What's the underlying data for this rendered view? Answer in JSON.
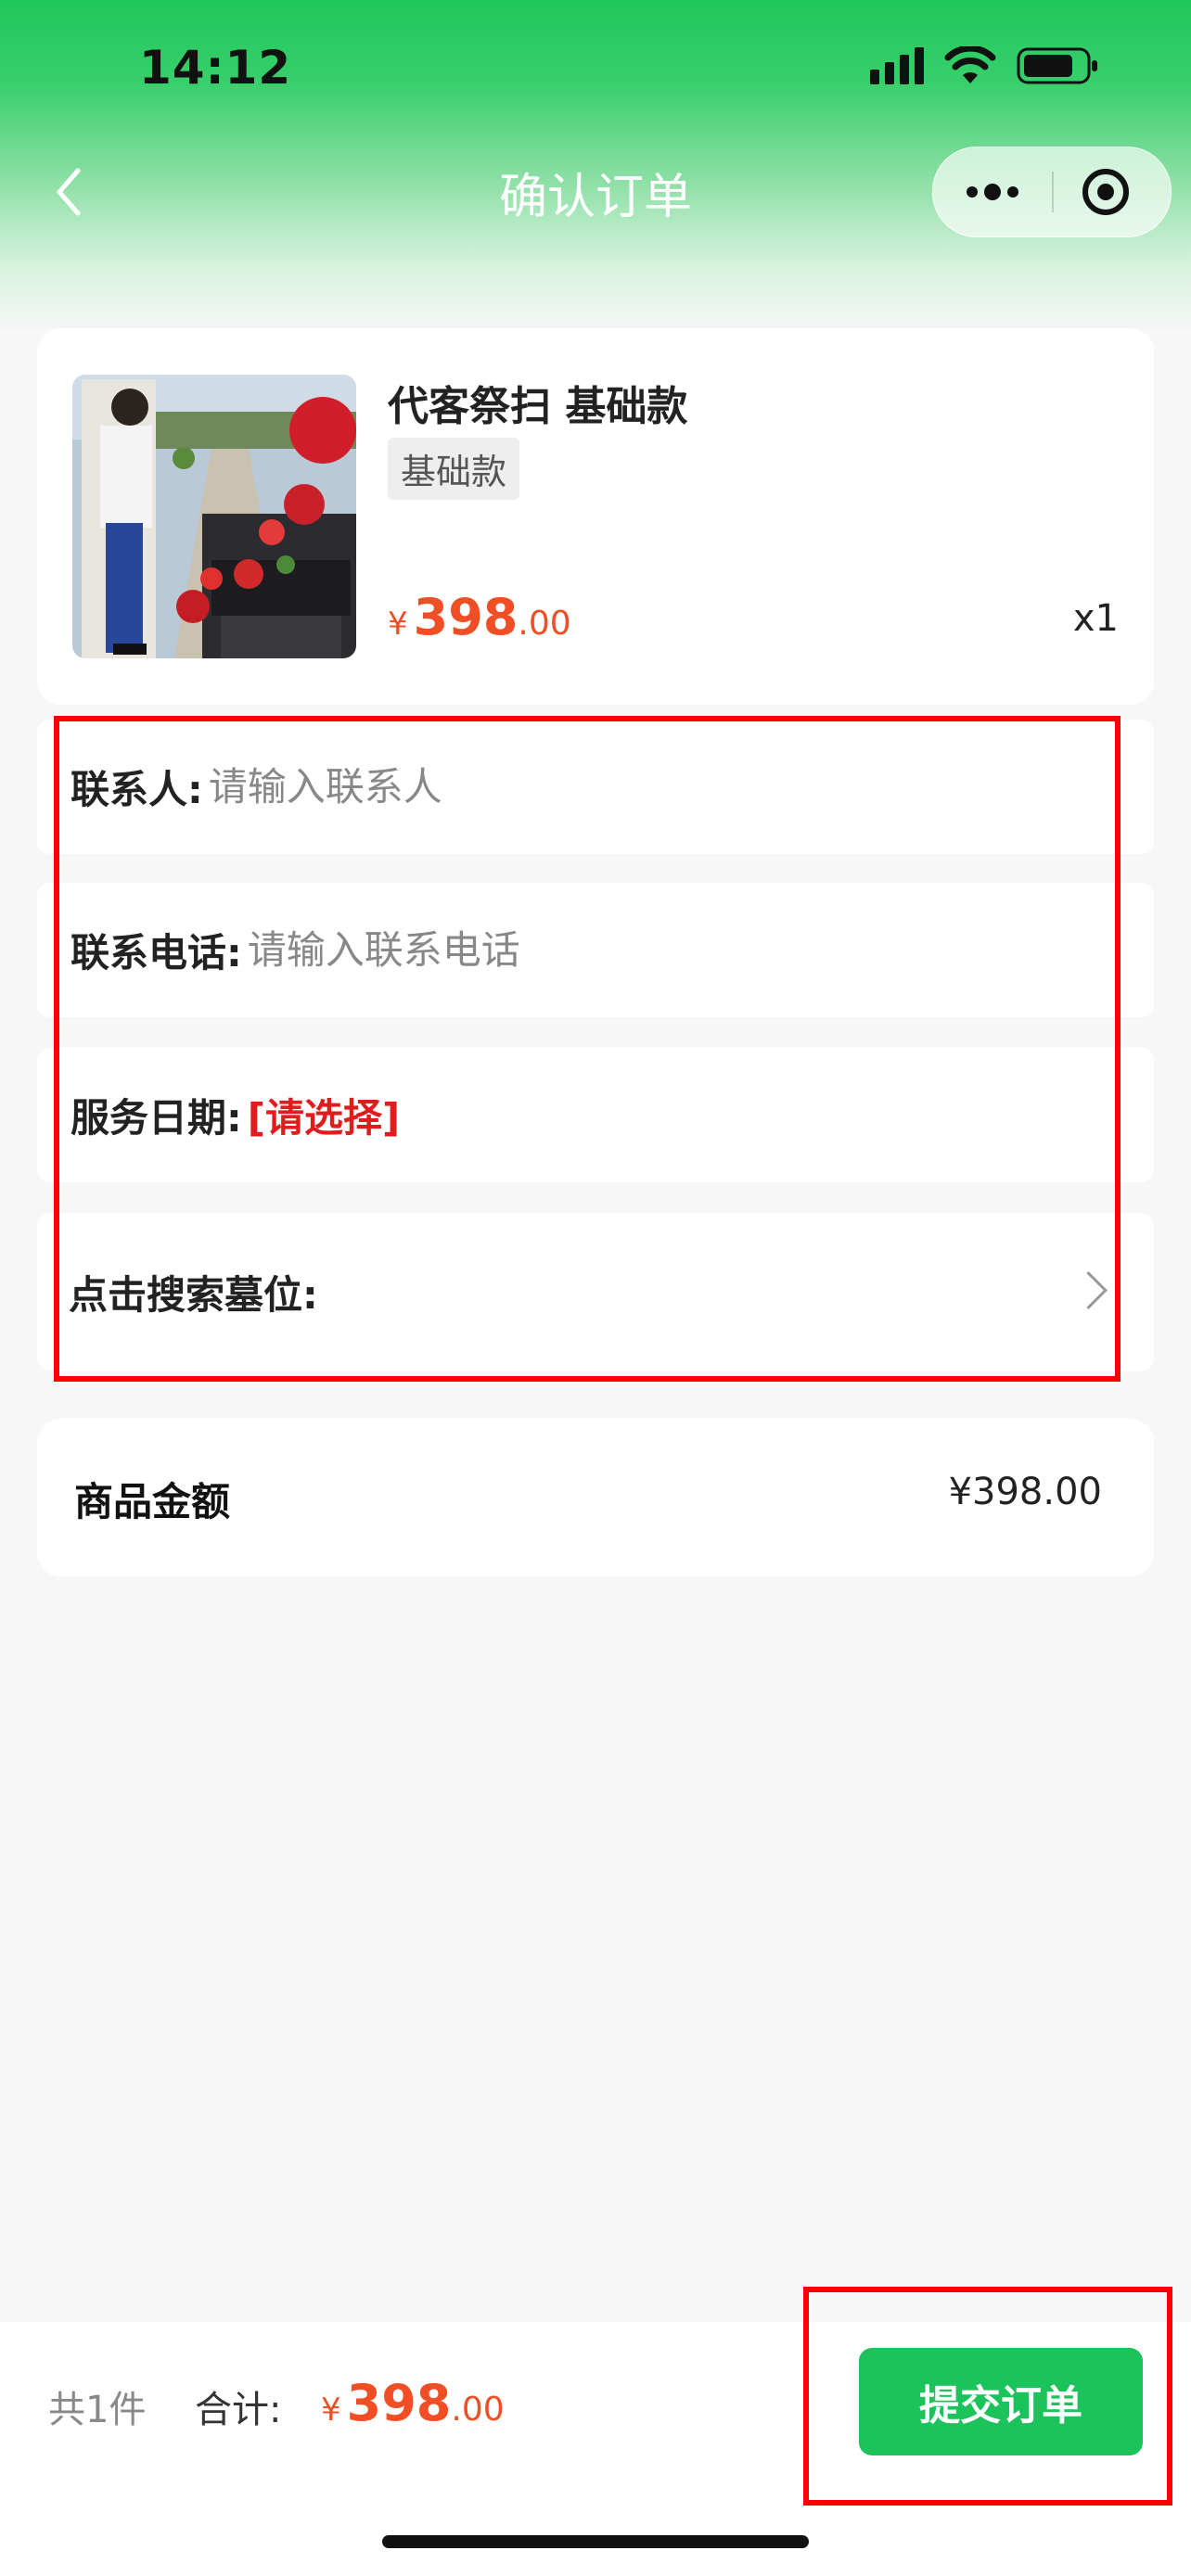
{
  "status_bar": {
    "time": "14:12",
    "icons": [
      "signal-icon",
      "wifi-icon",
      "battery-icon"
    ]
  },
  "nav": {
    "title": "确认订单",
    "icons": [
      "back-icon",
      "more-icon",
      "close-mini-program-icon"
    ]
  },
  "product": {
    "name": "代客祭扫 基础款",
    "spec": "基础款",
    "price_symbol": "¥",
    "price_int": "398",
    "price_dec": ".00",
    "quantity": "x1"
  },
  "form": {
    "contact_label": "联系人:",
    "contact_placeholder": "请输入联系人",
    "phone_label": "联系电话:",
    "phone_placeholder": "请输入联系电话",
    "date_label": "服务日期:",
    "date_value": "[请选择]",
    "tomb_label": "点击搜索墓位:"
  },
  "amount": {
    "label": "商品金额",
    "value": "¥398.00"
  },
  "footer": {
    "count": "共1件",
    "total_label": "合计:",
    "total_symbol": "¥",
    "total_int": "398",
    "total_dec": ".00",
    "submit_label": "提交订单"
  },
  "colors": {
    "brand_green": "#1cc35a",
    "price_orange": "#f04e24",
    "select_red": "#e01c1c",
    "highlight_red": "#ff0000"
  }
}
